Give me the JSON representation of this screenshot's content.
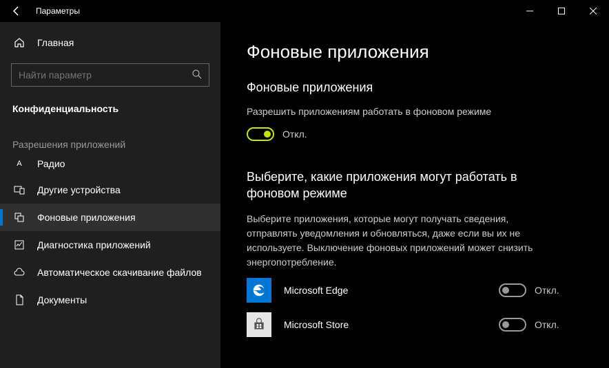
{
  "window": {
    "title": "Параметры"
  },
  "sidebar": {
    "home": "Главная",
    "search_placeholder": "Найти параметр",
    "category": "Конфиденциальность",
    "subheader": "Разрешения приложений",
    "items": [
      {
        "label": "Радио"
      },
      {
        "label": "Другие устройства"
      },
      {
        "label": "Фоновые приложения"
      },
      {
        "label": "Диагностика приложений"
      },
      {
        "label": "Автоматическое скачивание файлов"
      },
      {
        "label": "Документы"
      }
    ]
  },
  "content": {
    "heading": "Фоновые приложения",
    "section1_title": "Фоновые приложения",
    "section1_desc": "Разрешить приложениям работать в фоновом режиме",
    "master_toggle_state": "Откл.",
    "section2_title": "Выберите, какие приложения могут работать в фоновом режиме",
    "section2_desc": "Выберите приложения, которые могут получать сведения, отправлять уведомления и обновляться, даже если вы их не используете. Выключение фоновых приложений может снизить энергопотребление.",
    "apps": [
      {
        "name": "Microsoft Edge",
        "state": "Откл."
      },
      {
        "name": "Microsoft Store",
        "state": "Откл."
      }
    ]
  }
}
